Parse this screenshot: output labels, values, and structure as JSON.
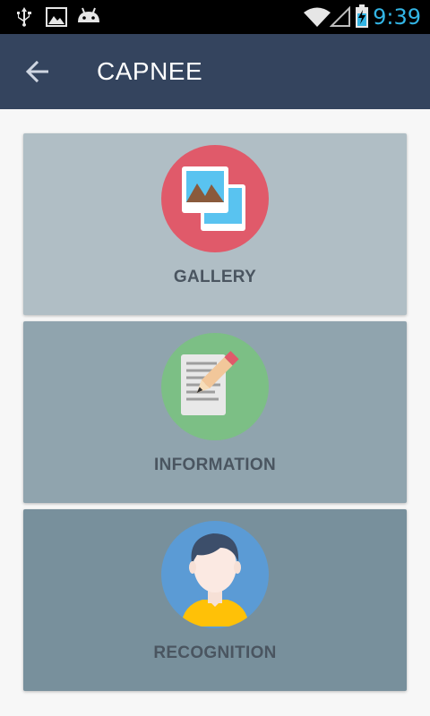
{
  "status_bar": {
    "time": "9:39",
    "time_color": "#33b5e5",
    "icons": [
      "usb-icon",
      "image-notification-icon",
      "android-debug-icon",
      "wifi-icon",
      "signal-icon",
      "battery-charging-icon"
    ]
  },
  "app_bar": {
    "title": "CAPNEE",
    "background": "#34445e",
    "back_icon": "arrow-left-icon"
  },
  "cards": [
    {
      "label": "GALLERY",
      "background": "#b0bec5",
      "circle_color": "#e05a6a",
      "icon": "gallery-icon"
    },
    {
      "label": "INFORMATION",
      "background": "#90a4ae",
      "circle_color": "#7cbf85",
      "icon": "document-edit-icon"
    },
    {
      "label": "RECOGNITION",
      "background": "#78909c",
      "circle_color": "#5b9bd5",
      "icon": "person-avatar-icon"
    }
  ]
}
